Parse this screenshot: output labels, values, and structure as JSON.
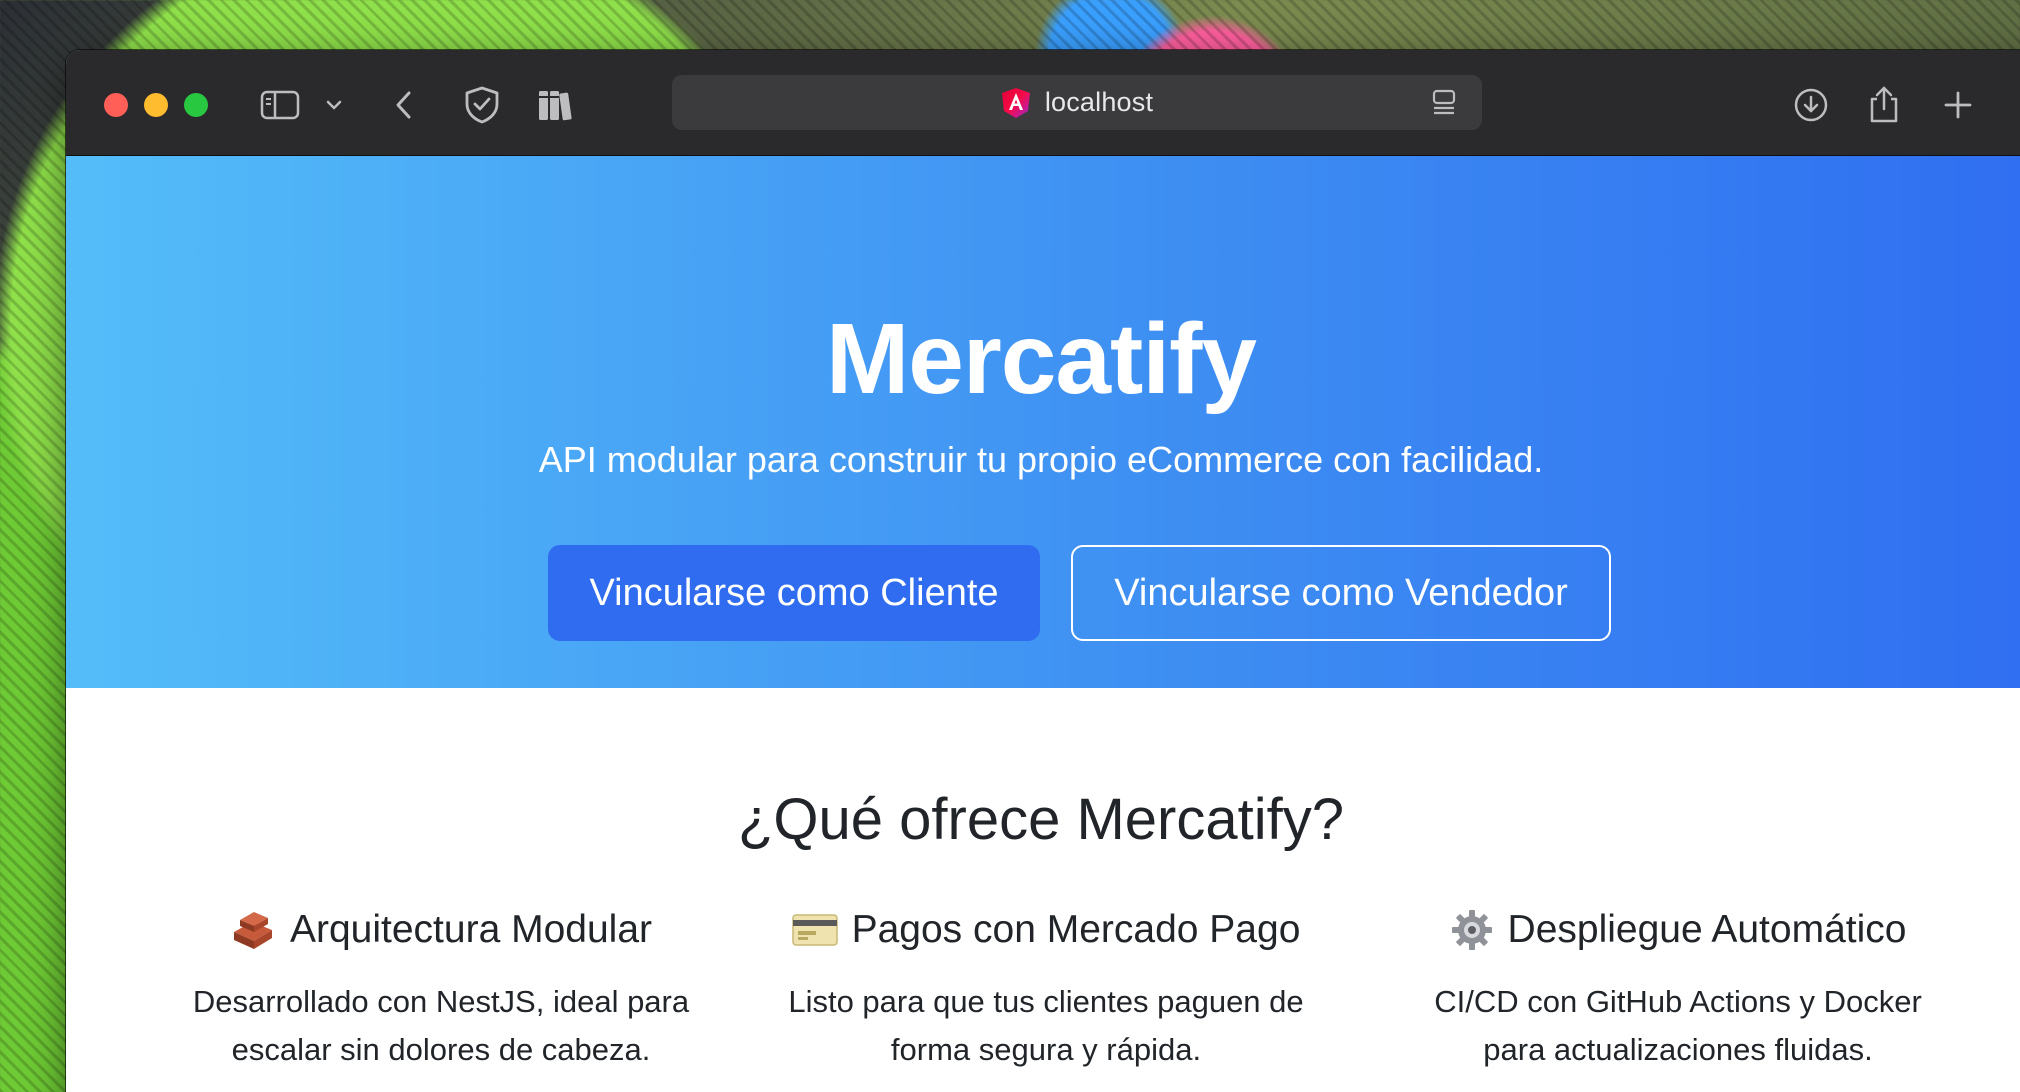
{
  "browser": {
    "url": "localhost"
  },
  "hero": {
    "title": "Mercatify",
    "subtitle": "API modular para construir tu propio eCommerce con facilidad.",
    "primary_button": "Vincularse como Cliente",
    "secondary_button": "Vincularse como Vendedor",
    "gradient_start": "#54bdf9",
    "gradient_end": "#2f6ef1"
  },
  "features": {
    "heading": "¿Qué ofrece Mercatify?",
    "items": [
      {
        "icon": "bricks-icon",
        "title": "Arquitectura Modular",
        "description": "Desarrollado con NestJS, ideal para escalar sin dolores de cabeza."
      },
      {
        "icon": "credit-card-icon",
        "title": "Pagos con Mercado Pago",
        "description": "Listo para que tus clientes paguen de forma segura y rápida."
      },
      {
        "icon": "gear-icon",
        "title": "Despliegue Automático",
        "description": "CI/CD con GitHub Actions y Docker para actualizaciones fluidas."
      }
    ]
  }
}
